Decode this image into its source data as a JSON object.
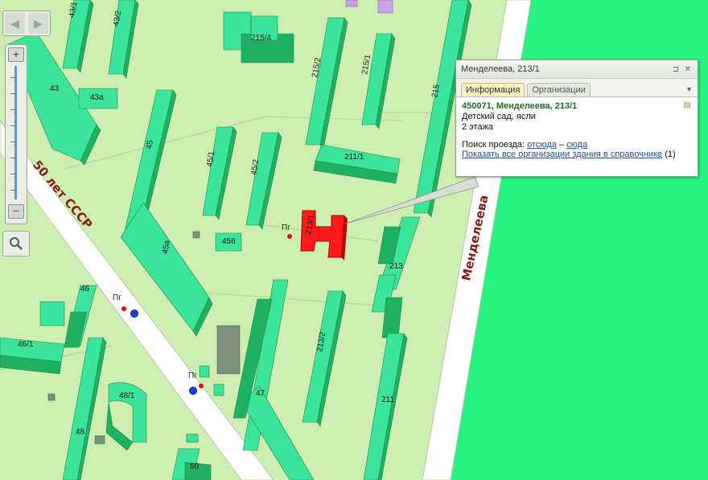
{
  "map": {
    "colors": {
      "background": "#cdeeb0",
      "forest": "#2af281",
      "road": "#ffffff",
      "building_top": "#3ce39a",
      "building_side": "#20b062",
      "highlight": "#ff1a1a"
    },
    "streets": [
      "50 лет СССР",
      "Менделеева"
    ],
    "building_labels": [
      "43/1",
      "43/2",
      "215/4",
      "43",
      "43а",
      "215/2",
      "215/1",
      "215",
      "45",
      "45/1",
      "45/2",
      "211/1",
      "456",
      "45а",
      "213/1",
      "213",
      "46",
      "46/1",
      "213/2",
      "47",
      "48/1",
      "48",
      "211",
      "50"
    ],
    "markers": {
      "pg_label": "Пг"
    }
  },
  "controls": {
    "back_icon": "arrow-left-icon",
    "forward_icon": "arrow-right-icon",
    "zoom_in": "+",
    "zoom_out": "−",
    "search_icon": "magnifier-icon"
  },
  "popup": {
    "title": "Менделеева, 213/1",
    "tabs": [
      "Информация",
      "Организации"
    ],
    "active_tab": "Информация",
    "address": "450071, Менделеева, 213/1",
    "description": "Детский сад, ясли",
    "floors": "2 этажа",
    "route_label": "Поиск проезда:",
    "route_from": "отсюда",
    "route_sep": "–",
    "route_to": "сюда",
    "show_orgs_link": "Показать все организации здания в справочнике",
    "show_orgs_count": "(1)"
  }
}
